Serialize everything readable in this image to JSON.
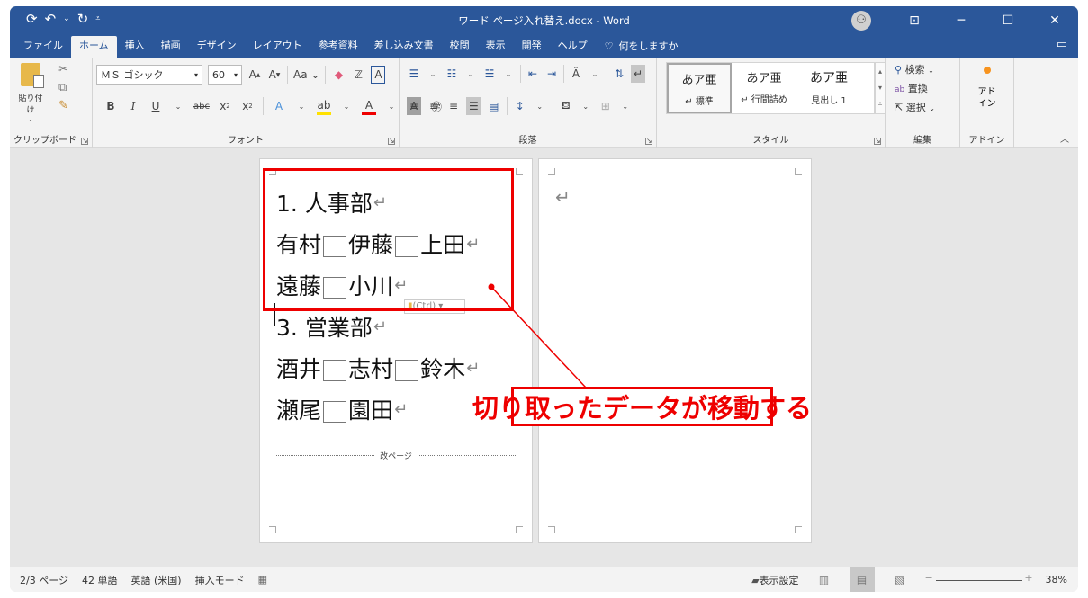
{
  "titlebar": {
    "title": "ワード ページ入れ替え.docx  -  Word",
    "qat": {
      "save_icon": "autosave-icon",
      "undo_icon": "undo-icon",
      "redo_icon": "redo-icon",
      "customize_icon": "customize-qat-icon"
    },
    "account_icon": "account-icon",
    "ribbon_display_icon": "ribbon-display-options-icon",
    "minimize": "─",
    "maximize": "☐",
    "close": "✕"
  },
  "tabs": [
    {
      "label": "ファイル",
      "active": false
    },
    {
      "label": "ホーム",
      "active": true
    },
    {
      "label": "挿入",
      "active": false
    },
    {
      "label": "描画",
      "active": false
    },
    {
      "label": "デザイン",
      "active": false
    },
    {
      "label": "レイアウト",
      "active": false
    },
    {
      "label": "参考資料",
      "active": false
    },
    {
      "label": "差し込み文書",
      "active": false
    },
    {
      "label": "校閲",
      "active": false
    },
    {
      "label": "表示",
      "active": false
    },
    {
      "label": "開発",
      "active": false
    },
    {
      "label": "ヘルプ",
      "active": false
    }
  ],
  "tell_me": "何をしますか",
  "ribbon": {
    "clipboard": {
      "label": "クリップボード",
      "paste": "貼り付け"
    },
    "font": {
      "label": "フォント",
      "font_name": "ＭＳ ゴシック",
      "font_size": "60",
      "case_label": "Aa"
    },
    "paragraph": {
      "label": "段落"
    },
    "styles": {
      "label": "スタイル",
      "items": [
        {
          "sample": "あア亜",
          "name": "↵ 標準",
          "selected": true
        },
        {
          "sample": "あア亜",
          "name": "↵ 行間詰め",
          "selected": false
        },
        {
          "sample": "あア亜",
          "name": "見出し 1",
          "selected": false
        }
      ]
    },
    "editing": {
      "label": "編集",
      "find": "検索",
      "replace": "置換",
      "select": "選択"
    },
    "addins": {
      "label": "アドイン",
      "button": "アド\nイン"
    }
  },
  "document": {
    "page1": {
      "lines": [
        "1. 人事部",
        "有村□伊藤□上田",
        "遠藤□小川",
        "3. 営業部",
        "酒井□志村□鈴木",
        "瀬尾□園田"
      ],
      "page_break_label": "改ページ",
      "paste_options": "(Ctrl)"
    },
    "page2": {
      "lines": [
        ""
      ]
    }
  },
  "annotation": {
    "label": "切り取ったデータが移動する",
    "color": "#e00000"
  },
  "statusbar": {
    "page": "2/3 ページ",
    "words": "42 単語",
    "language": "英語 (米国)",
    "mode": "挿入モード",
    "display_settings": "表示設定",
    "zoom": "38%",
    "zoom_fraction": 0.38
  },
  "colors": {
    "brand": "#2b579a",
    "annotation": "#e00000"
  }
}
